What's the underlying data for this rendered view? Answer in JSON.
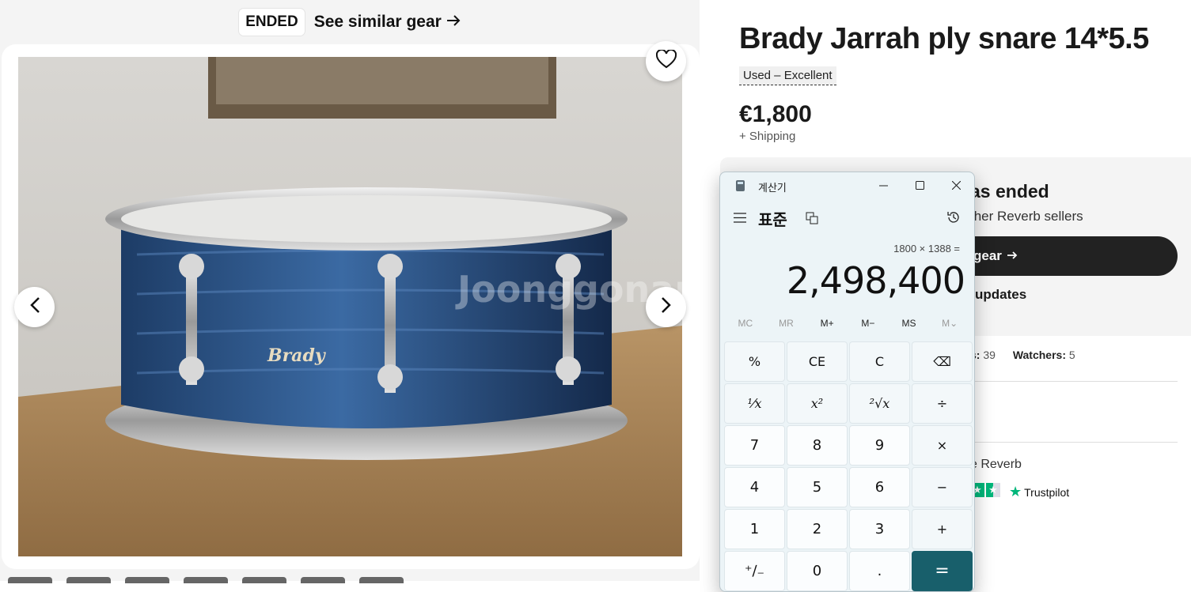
{
  "listing": {
    "ended_badge": "ENDED",
    "see_similar": "See similar gear",
    "title": "Brady Jarrah ply snare 14*5.5",
    "condition": "Used – Excellent",
    "price": "€1,800",
    "shipping": "+ Shipping",
    "ended_box": {
      "title_partial": "as ended",
      "subtitle_partial": "ther Reverb sellers",
      "button_partial": "gear",
      "updates_partial": "updates"
    },
    "stats": {
      "views_label": "s:",
      "views_value": "39",
      "watchers_label": "Watchers:",
      "watchers_value": "5"
    },
    "reverb_text_partial": "e Reverb",
    "trustpilot_label": "Trustpilot"
  },
  "photo": {
    "drum_logo": "Brady",
    "watermark": "Joonggonara"
  },
  "calculator": {
    "window_title": "계산기",
    "mode": "표준",
    "expression": "1800 × 1388 =",
    "display": "2,498,400",
    "memory": [
      "MC",
      "MR",
      "M+",
      "M−",
      "MS",
      "M⌄"
    ],
    "keys": [
      {
        "label": "%",
        "kind": "op"
      },
      {
        "label": "CE",
        "kind": "op"
      },
      {
        "label": "C",
        "kind": "op"
      },
      {
        "label": "⌫",
        "kind": "op"
      },
      {
        "label": "¹⁄x",
        "kind": "op serif"
      },
      {
        "label": "x²",
        "kind": "op serif"
      },
      {
        "label": "²√x",
        "kind": "op serif"
      },
      {
        "label": "÷",
        "kind": "op"
      },
      {
        "label": "7",
        "kind": "num"
      },
      {
        "label": "8",
        "kind": "num"
      },
      {
        "label": "9",
        "kind": "num"
      },
      {
        "label": "×",
        "kind": "op"
      },
      {
        "label": "4",
        "kind": "num"
      },
      {
        "label": "5",
        "kind": "num"
      },
      {
        "label": "6",
        "kind": "num"
      },
      {
        "label": "−",
        "kind": "op"
      },
      {
        "label": "1",
        "kind": "num"
      },
      {
        "label": "2",
        "kind": "num"
      },
      {
        "label": "3",
        "kind": "num"
      },
      {
        "label": "+",
        "kind": "op"
      },
      {
        "label": "⁺∕₋",
        "kind": "num"
      },
      {
        "label": "0",
        "kind": "num"
      },
      {
        "label": ".",
        "kind": "num"
      },
      {
        "label": "=",
        "kind": "eq"
      }
    ],
    "accent_color": "#185f6b"
  },
  "colors": {
    "trustpilot_green": "#00b67a",
    "dark_button": "#222222"
  }
}
